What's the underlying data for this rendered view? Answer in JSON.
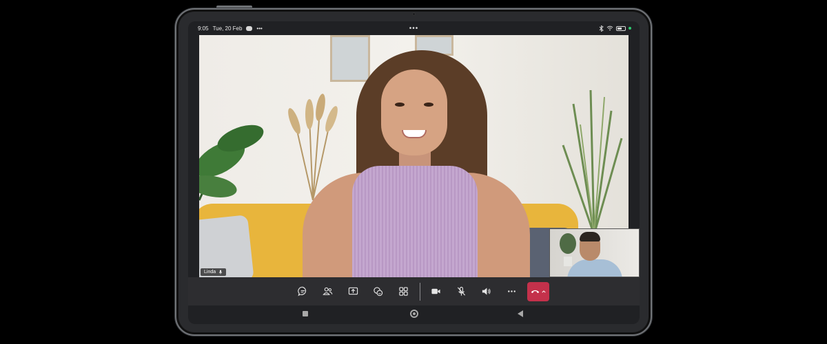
{
  "status_bar": {
    "time": "9:05",
    "date": "Tue, 20 Feb",
    "center_indicator": "•••",
    "more_dots": "•••"
  },
  "participants": {
    "remote_name": "Linda",
    "remote_mic_icon": "mic-icon"
  },
  "controls": [
    {
      "name": "chat-button",
      "icon": "chat-icon"
    },
    {
      "name": "people-button",
      "icon": "people-icon"
    },
    {
      "name": "share-screen-button",
      "icon": "share-screen-icon"
    },
    {
      "name": "reactions-button",
      "icon": "reactions-icon"
    },
    {
      "name": "view-layout-button",
      "icon": "grid-icon"
    },
    {
      "name": "camera-button",
      "icon": "video-camera-icon"
    },
    {
      "name": "mute-button",
      "icon": "mic-off-icon"
    },
    {
      "name": "speaker-button",
      "icon": "speaker-icon"
    },
    {
      "name": "more-options-button",
      "icon": "more-horizontal-icon"
    },
    {
      "name": "hang-up-button",
      "icon": "phone-hangup-icon"
    }
  ],
  "colors": {
    "hangup": "#c4314b",
    "control_bar": "#2d2d30",
    "status_online": "#2ecc71"
  }
}
